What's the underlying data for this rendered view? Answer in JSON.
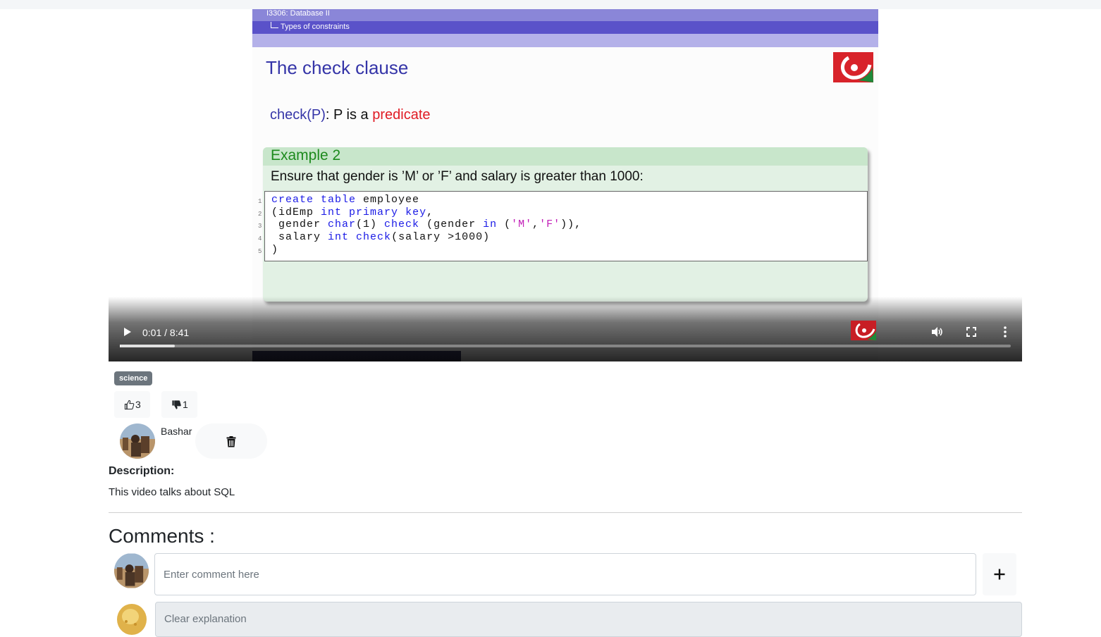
{
  "video": {
    "slide": {
      "breadcrumb_course": "I3306: Database II",
      "breadcrumb_section": "Types of constraints",
      "title": "The check clause",
      "check_prefix": "check(P)",
      "check_middle": ": P is a ",
      "check_highlight": "predicate",
      "example_title": "Example 2",
      "example_text": "Ensure that gender is ’M’ or ’F’ and salary is greater than 1000:",
      "line_numbers": [
        "1",
        "2",
        "3",
        "4",
        "5"
      ]
    },
    "time_display": "0:01 / 8:41",
    "progress_played": 0.0002,
    "progress_buffered": 0.062
  },
  "tag": "science",
  "likes": {
    "up": "3",
    "down": "1"
  },
  "author": "Bashar",
  "description": {
    "label": "Description:",
    "text": "This video talks about SQL"
  },
  "comments": {
    "title": "Comments :",
    "input_placeholder": "Enter comment here",
    "items": [
      {
        "text": "Clear explanation"
      }
    ]
  },
  "colors": {
    "slide_title": "#3535a8",
    "highlight": "#e01b24",
    "example_green": "#1d8a1d",
    "code_keyword": "#1a1ae6",
    "code_string": "#c21fb8",
    "tag_bg": "#6c757d"
  },
  "icons": [
    "play-icon",
    "volume-icon",
    "fullscreen-icon",
    "more-vert-icon",
    "thumbs-up-icon",
    "thumbs-down-icon",
    "trash-icon",
    "plus-icon"
  ]
}
